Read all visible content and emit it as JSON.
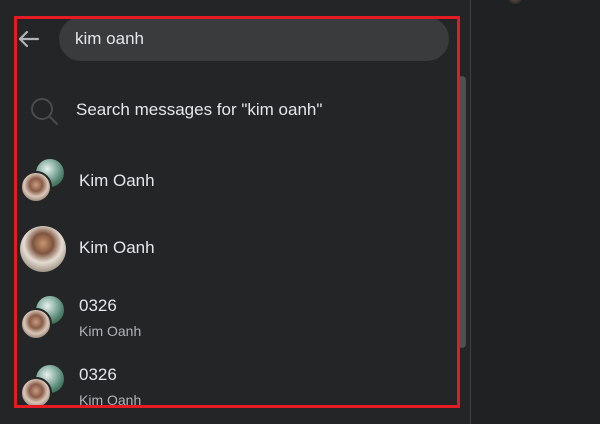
{
  "search": {
    "query": "kim oanh"
  },
  "search_messages": {
    "label": "Search messages for \"kim oanh\""
  },
  "results": [
    {
      "name": "Kim Oanh",
      "sub": "",
      "avatar": "group"
    },
    {
      "name": "Kim Oanh",
      "sub": "",
      "avatar": "single"
    },
    {
      "name": "0326",
      "sub": "Kim Oanh",
      "avatar": "group"
    },
    {
      "name": "0326",
      "sub": "Kim Oanh",
      "avatar": "group"
    }
  ],
  "colors": {
    "panel_bg": "#242526",
    "search_bg": "#3a3b3c",
    "text_primary": "#e4e6eb",
    "text_secondary": "#b0b3b8",
    "highlight_frame": "#e41b23"
  },
  "icons": {
    "back": "arrow-left-icon",
    "search": "search-icon"
  }
}
